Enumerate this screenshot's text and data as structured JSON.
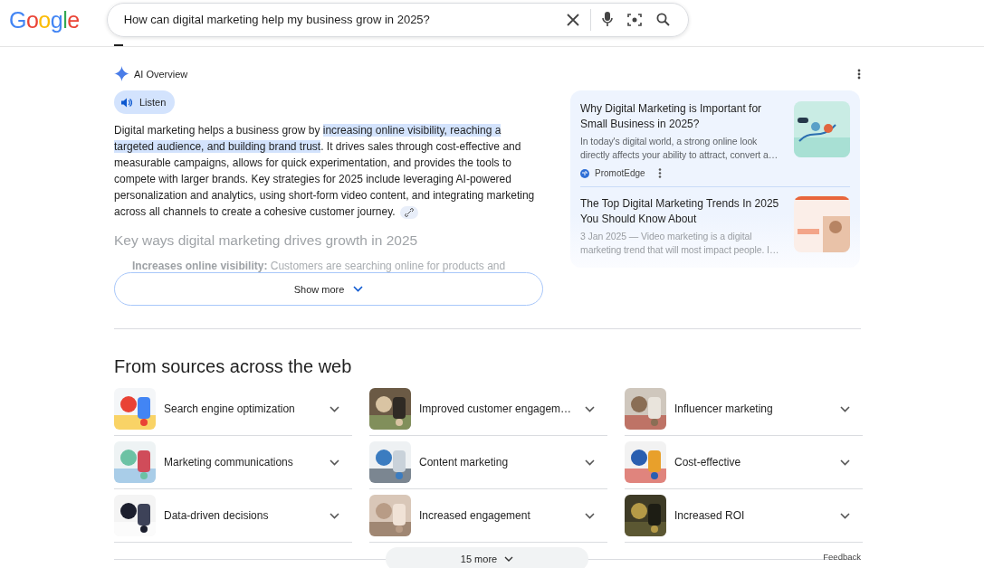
{
  "logo": "Google",
  "search": {
    "value": "How can digital marketing help my business grow in 2025?"
  },
  "ai_overview": {
    "label": "AI Overview",
    "listen": "Listen",
    "summary": {
      "before": "Digital marketing helps a business grow by ",
      "highlight": "increasing online visibility, reaching a targeted audience, and building brand trust",
      "after": ". It drives sales through cost-effective and measurable campaigns, allows for quick experimentation, and provides the tools to compete with larger brands. Key strategies for 2025 include leveraging AI-powered personalization and analytics, using short-form video content, and integrating marketing across all channels to create a cohesive customer journey."
    },
    "heading": "Key ways digital marketing drives growth in 2025",
    "bullet": "**Increases online visibility:** Customers are searching online for products and",
    "show_more": "Show more"
  },
  "sources": [
    {
      "title": "Why Digital Marketing is Important for Small Business in 2025?",
      "snippet": "In today's digital world, a strong online look directly affects your ability to attract, convert a…",
      "site": "PromotEdge"
    },
    {
      "title": "The Top Digital Marketing Trends In 2025 You Should Know About",
      "snippet": "3 Jan 2025 — Video marketing is a digital marketing trend that will most impact people. I…"
    }
  ],
  "web_sources": {
    "heading": "From sources across the web",
    "items": [
      {
        "label": "Search engine optimization"
      },
      {
        "label": "Improved customer engagem…"
      },
      {
        "label": "Influencer marketing"
      },
      {
        "label": "Marketing communications"
      },
      {
        "label": "Content marketing"
      },
      {
        "label": "Cost-effective"
      },
      {
        "label": "Data-driven decisions"
      },
      {
        "label": "Increased engagement"
      },
      {
        "label": "Increased ROI"
      }
    ],
    "more": "15 more",
    "feedback": "Feedback"
  }
}
